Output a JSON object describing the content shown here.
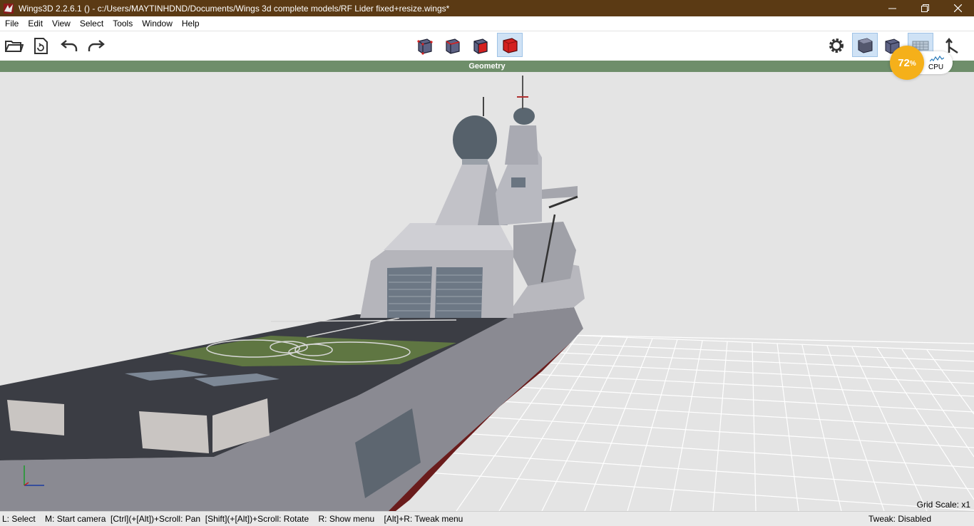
{
  "window": {
    "title": "Wings3D 2.2.6.1 () - c:/Users/MAYTINHDND/Documents/Wings 3d complete models/RF Lider fixed+resize.wings*",
    "icons": {
      "app": "wings3d-app-icon",
      "minimize": "minimize-icon",
      "restore": "restore-icon",
      "close": "close-icon"
    }
  },
  "menu": {
    "items": [
      {
        "label": "File"
      },
      {
        "label": "Edit"
      },
      {
        "label": "View"
      },
      {
        "label": "Select"
      },
      {
        "label": "Tools"
      },
      {
        "label": "Window"
      },
      {
        "label": "Help"
      }
    ]
  },
  "toolbar": {
    "left": [
      "open-folder-icon",
      "save-icon",
      "undo-icon",
      "redo-icon"
    ],
    "select_modes": [
      {
        "name": "vertex-mode-icon",
        "active": false
      },
      {
        "name": "edge-mode-icon",
        "active": false
      },
      {
        "name": "face-mode-icon",
        "active": false
      },
      {
        "name": "body-mode-icon",
        "active": true
      }
    ],
    "right": [
      {
        "name": "preferences-gear-icon",
        "active": false
      },
      {
        "name": "smooth-shading-icon",
        "active": true
      },
      {
        "name": "flat-shading-icon",
        "active": false
      },
      {
        "name": "groundplane-icon",
        "active": true
      },
      {
        "name": "axes-toggle-icon",
        "active": false
      }
    ]
  },
  "viewport": {
    "header": "Geometry",
    "grid_scale": "Grid Scale: x1",
    "background": "#e4e4e4"
  },
  "cpu_widget": {
    "percent": "72",
    "unit": "%",
    "label": "CPU",
    "color": "#f5b01a"
  },
  "statusbar": {
    "hints": "L: Select    M: Start camera  [Ctrl](+[Alt])+Scroll: Pan  [Shift](+[Alt])+Scroll: Rotate    R: Show menu    [Alt]+R: Tweak menu",
    "tweak": "Tweak: Disabled"
  },
  "colors": {
    "titlebar": "#5b3a14",
    "header": "#6e8e6a",
    "body_mode_red": "#d42020"
  }
}
